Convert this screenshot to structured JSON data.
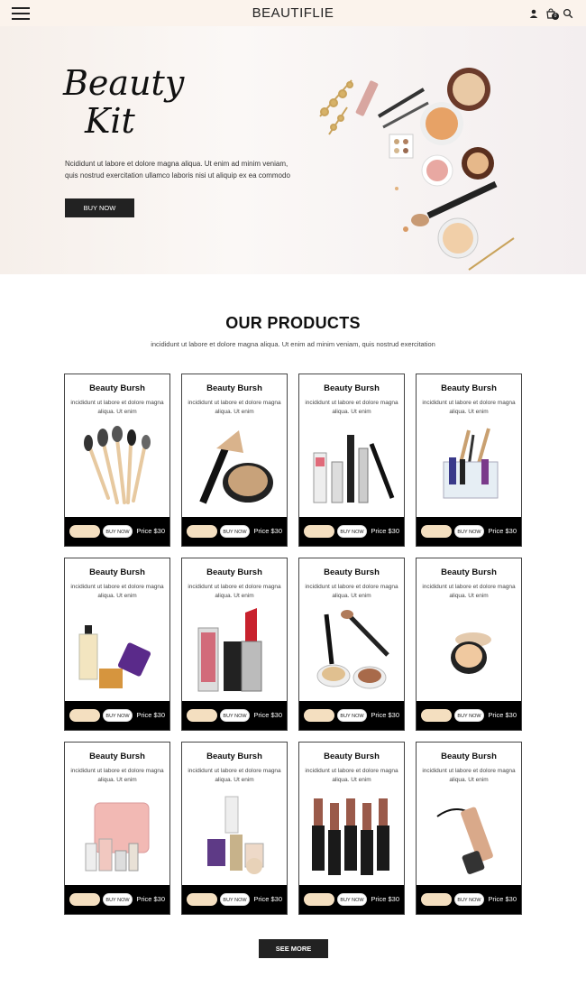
{
  "header": {
    "brand": "BEAUTIFLIE",
    "cart_count": "0"
  },
  "hero": {
    "title_line1": "Beauty",
    "title_line2": "Kit",
    "text": "Ncididunt ut labore et dolore magna aliqua. Ut enim ad minim veniam, quis nostrud exercitation ullamco laboris nisi ut aliquip ex ea commodo",
    "button": "BUY NOW"
  },
  "products_section": {
    "title": "OUR PRODUCTS",
    "subtitle": "incididunt ut labore et dolore magna aliqua. Ut enim ad minim veniam, quis nostrud exercitation"
  },
  "products": [
    {
      "title": "Beauty Bursh",
      "desc": "incididunt ut labore et dolore magna aliqua. Ut enim",
      "cart": "Add to cart",
      "buy": "BUY NOW",
      "price": "Price $30",
      "icon": "brushes-icon"
    },
    {
      "title": "Beauty Bursh",
      "desc": "incididunt ut labore et dolore magna aliqua. Ut enim",
      "cart": "Add to cart",
      "buy": "BUY NOW",
      "price": "Price $30",
      "icon": "powder-compact-icon"
    },
    {
      "title": "Beauty Bursh",
      "desc": "incididunt ut labore et dolore magna aliqua. Ut enim",
      "cart": "Add to cart",
      "buy": "BUY NOW",
      "price": "Price $30",
      "icon": "mascara-set-icon"
    },
    {
      "title": "Beauty Bursh",
      "desc": "incididunt ut labore et dolore magna aliqua. Ut enim",
      "cart": "Add to cart",
      "buy": "BUY NOW",
      "price": "Price $30",
      "icon": "organizer-icon"
    },
    {
      "title": "Beauty Bursh",
      "desc": "incididunt ut labore et dolore magna aliqua. Ut enim",
      "cart": "Add to cart",
      "buy": "BUY NOW",
      "price": "Price $30",
      "icon": "bottles-icon"
    },
    {
      "title": "Beauty Bursh",
      "desc": "incididunt ut labore et dolore magna aliqua. Ut enim",
      "cart": "Add to cart",
      "buy": "BUY NOW",
      "price": "Price $30",
      "icon": "lipstick-icon"
    },
    {
      "title": "Beauty Bursh",
      "desc": "incididunt ut labore et dolore magna aliqua. Ut enim",
      "cart": "Add to cart",
      "buy": "BUY NOW",
      "price": "Price $30",
      "icon": "makeup-kit-icon"
    },
    {
      "title": "Beauty Bursh",
      "desc": "incididunt ut labore et dolore magna aliqua. Ut enim",
      "cart": "Add to cart",
      "buy": "BUY NOW",
      "price": "Price $30",
      "icon": "compact-icon"
    },
    {
      "title": "Beauty Bursh",
      "desc": "incididunt ut labore et dolore magna aliqua. Ut enim",
      "cart": "Add to cart",
      "buy": "BUY NOW",
      "price": "Price $30",
      "icon": "cosmetic-bag-icon"
    },
    {
      "title": "Beauty Bursh",
      "desc": "incididunt ut labore et dolore magna aliqua. Ut enim",
      "cart": "Add to cart",
      "buy": "BUY NOW",
      "price": "Price $30",
      "icon": "perfume-set-icon"
    },
    {
      "title": "Beauty Bursh",
      "desc": "incididunt ut labore et dolore magna aliqua. Ut enim",
      "cart": "Add to cart",
      "buy": "BUY NOW",
      "price": "Price $30",
      "icon": "lipstick-collection-icon"
    },
    {
      "title": "Beauty Bursh",
      "desc": "incididunt ut labore et dolore magna aliqua. Ut enim",
      "cart": "Add to cart",
      "buy": "BUY NOW",
      "price": "Price $30",
      "icon": "eyeliner-icon"
    }
  ],
  "see_more": "SEE MORE",
  "colors": {
    "header_bg": "#fbf3ec",
    "button_dark": "#222222",
    "cart_pill": "#f4dfc0",
    "card_bar": "#000000"
  }
}
